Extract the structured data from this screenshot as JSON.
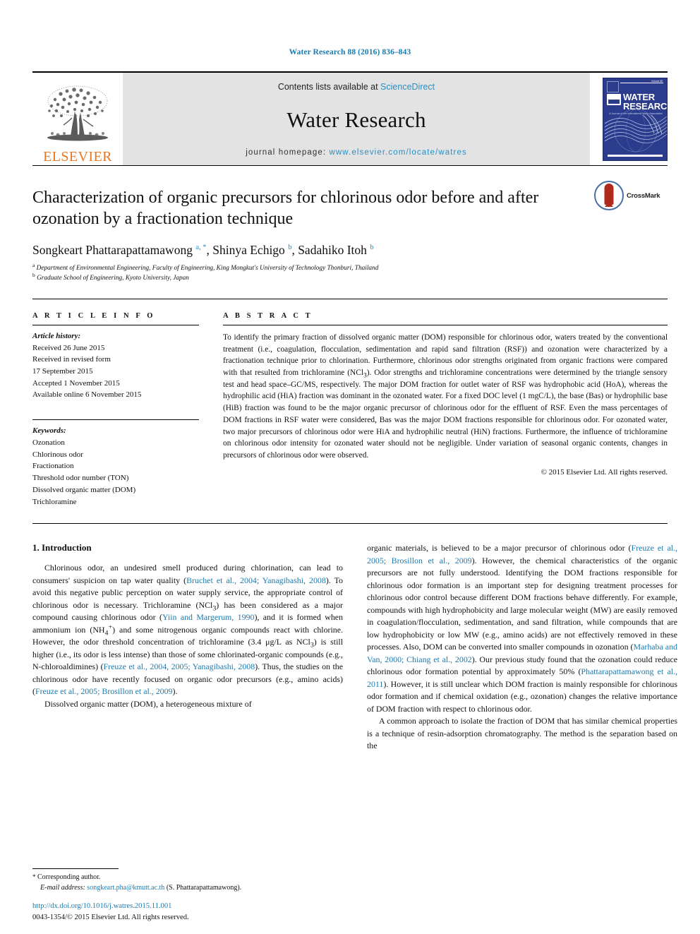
{
  "running_head": "Water Research 88 (2016) 836–843",
  "masthead": {
    "publisher_name": "ELSEVIER",
    "contents_prefix": "Contents lists available at ",
    "contents_link": "ScienceDirect",
    "journal_title": "Water Research",
    "homepage_prefix": "journal homepage: ",
    "homepage_url": "www.elsevier.com/locate/watres",
    "cover_title_line1": "WATER",
    "cover_title_line2": "RESEARCH",
    "cover_volume": "Volume 88",
    "cover_subtitle": "A Journal of the International Water Association",
    "link_color": "#2b8fc4",
    "elsevier_orange": "#E87722",
    "cover_blue": "#2b3c8c"
  },
  "article": {
    "title": "Characterization of organic precursors for chlorinous odor before and after ozonation by a fractionation technique",
    "crossmark_label": "CrossMark",
    "authors_html": "Songkeart Phattarapattamawong <sup>a, *</sup>, Shinya Echigo <sup>b</sup>, Sadahiko Itoh <sup>b</sup>",
    "affiliation_a": "Department of Environmental Engineering, Faculty of Engineering, King Mongkut's University of Technology Thonburi, Thailand",
    "affiliation_b": "Graduate School of Engineering, Kyoto University, Japan"
  },
  "article_info": {
    "heading": "A R T I C L E  I N F O",
    "history_label": "Article history:",
    "history": [
      "Received 26 June 2015",
      "Received in revised form",
      "17 September 2015",
      "Accepted 1 November 2015",
      "Available online 6 November 2015"
    ],
    "keywords_label": "Keywords:",
    "keywords": [
      "Ozonation",
      "Chlorinous odor",
      "Fractionation",
      "Threshold odor number (TON)",
      "Dissolved organic matter (DOM)",
      "Trichloramine"
    ]
  },
  "abstract": {
    "heading": "A B S T R A C T",
    "text": "To identify the primary fraction of dissolved organic matter (DOM) responsible for chlorinous odor, waters treated by the conventional treatment (i.e., coagulation, flocculation, sedimentation and rapid sand filtration (RSF)) and ozonation were characterized by a fractionation technique prior to chlorination. Furthermore, chlorinous odor strengths originated from organic fractions were compared with that resulted from trichloramine (NCl3). Odor strengths and trichloramine concentrations were determined by the triangle sensory test and head space–GC/MS, respectively. The major DOM fraction for outlet water of RSF was hydrophobic acid (HoA), whereas the hydrophilic acid (HiA) fraction was dominant in the ozonated water. For a fixed DOC level (1 mgC/L), the base (Bas) or hydrophilic base (HiB) fraction was found to be the major organic precursor of chlorinous odor for the effluent of RSF. Even the mass percentages of DOM fractions in RSF water were considered, Bas was the major DOM fractions responsible for chlorinous odor. For ozonated water, two major precursors of chlorinous odor were HiA and hydrophilic neutral (HiN) fractions. Furthermore, the influence of trichloramine on chlorinous odor intensity for ozonated water should not be negligible. Under variation of seasonal organic contents, changes in precursors of chlorinous odor were observed.",
    "copyright": "© 2015 Elsevier Ltd. All rights reserved."
  },
  "body": {
    "section_title": "1. Introduction",
    "left_paragraphs": [
      "Chlorinous odor, an undesired smell produced during chlorination, can lead to consumers' suspicion on tap water quality (Bruchet et al., 2004; Yanagibashi, 2008). To avoid this negative public perception on water supply service, the appropriate control of chlorinous odor is necessary. Trichloramine (NCl3) has been considered as a major compound causing chlorinous odor (Yiin and Margerum, 1990), and it is formed when ammonium ion (NH4+) and some nitrogenous organic compounds react with chlorine. However, the odor threshold concentration of trichloramine (3.4 μg/L as NCl3) is still higher (i.e., its odor is less intense) than those of some chlorinated-organic compounds (e.g., N-chloroaldimines) (Freuze et al., 2004, 2005; Yanagibashi, 2008). Thus, the studies on the chlorinous odor have recently focused on organic odor precursors (e.g., amino acids) (Freuze et al., 2005; Brosillon et al., 2009).",
      "Dissolved organic matter (DOM), a heterogeneous mixture of"
    ],
    "right_paragraphs": [
      "organic materials, is believed to be a major precursor of chlorinous odor (Freuze et al., 2005; Brosillon et al., 2009). However, the chemical characteristics of the organic precursors are not fully understood. Identifying the DOM fractions responsible for chlorinous odor formation is an important step for designing treatment processes for chlorinous odor control because different DOM fractions behave differently. For example, compounds with high hydrophobicity and large molecular weight (MW) are easily removed in coagulation/flocculation, sedimentation, and sand filtration, while compounds that are low hydrophobicity or low MW (e.g., amino acids) are not effectively removed in these processes. Also, DOM can be converted into smaller compounds in ozonation (Marhaba and Van, 2000; Chiang et al., 2002). Our previous study found that the ozonation could reduce chlorinous odor formation potential by approximately 50% (Phattarapattamawong et al., 2011). However, it is still unclear which DOM fraction is mainly responsible for chlorinous odor formation and if chemical oxidation (e.g., ozonation) changes the relative importance of DOM fraction with respect to chlorinous odor.",
      "A common approach to isolate the fraction of DOM that has similar chemical properties is a technique of resin-adsorption chromatography. The method is the separation based on the"
    ]
  },
  "footer": {
    "corresponding_marker": "*",
    "corresponding_text": "Corresponding author.",
    "email_label": "E-mail address:",
    "email": "songkeart.pha@kmutt.ac.th",
    "email_attribution": "(S. Phattarapattamawong).",
    "doi": "http://dx.doi.org/10.1016/j.watres.2015.11.001",
    "issn_line": "0043-1354/© 2015 Elsevier Ltd. All rights reserved."
  }
}
